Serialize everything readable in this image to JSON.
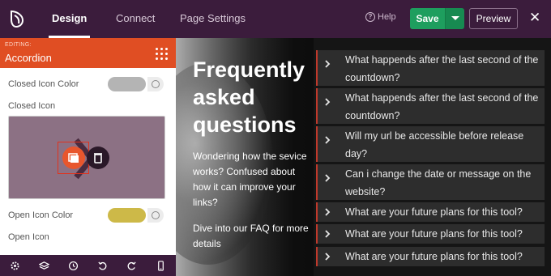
{
  "topbar": {
    "tabs": [
      {
        "label": "Design",
        "active": true
      },
      {
        "label": "Connect",
        "active": false
      },
      {
        "label": "Page Settings",
        "active": false
      }
    ],
    "help_label": "Help",
    "help_icon": "question-circle-icon",
    "save_label": "Save",
    "preview_label": "Preview",
    "close_label": "✕"
  },
  "sidebar": {
    "editing_label": "EDITING:",
    "editing_name": "Accordion",
    "closed_icon_color_label": "Closed Icon Color",
    "closed_icon_color": "#b4b4b4",
    "closed_icon_label": "Closed Icon",
    "open_icon_color_label": "Open Icon Color",
    "open_icon_color": "#cdb948",
    "open_icon_label": "Open Icon",
    "footer_icons": [
      "settings-icon",
      "layers-icon",
      "history-icon",
      "undo-icon",
      "redo-icon",
      "mobile-preview-icon"
    ]
  },
  "canvas": {
    "hero_title": "Frequently asked questions",
    "hero_text": "Wondering how the sevice works? Confused about how it can improve your links?",
    "hero_text2": "Dive into our FAQ for more details",
    "faq": [
      "What happends after the last second of the countdown?",
      "What happends after the last second of the countdown?",
      "Will my url be accessible before release day?",
      "Can i change the date or message on the website?",
      "What are your future plans for this tool?",
      "What are your future plans for this tool?",
      "What are your future plans for this tool?"
    ]
  },
  "colors": {
    "topbar_bg": "#3b1c3c",
    "accent_orange": "#e04e23",
    "save_green": "#1e9e5e",
    "faq_border": "#c0392b"
  }
}
